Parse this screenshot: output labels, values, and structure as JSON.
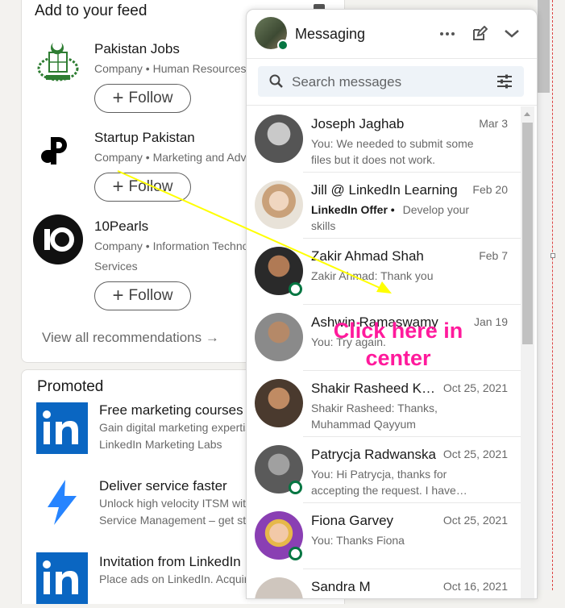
{
  "feed": {
    "title": "Add to your feed",
    "items": [
      {
        "name": "Pakistan Jobs",
        "sub": "Company • Human Resources",
        "sub2": "",
        "follow": "Follow"
      },
      {
        "name": "Startup Pakistan",
        "sub": "Company • Marketing and Advertising",
        "sub2": "",
        "follow": "Follow"
      },
      {
        "name": "10Pearls",
        "sub": "Company • Information Technology",
        "sub2": "Services",
        "follow": "Follow"
      }
    ],
    "view_all": "View all recommendations →"
  },
  "promoted": {
    "title": "Promoted",
    "items": [
      {
        "title": "Free marketing courses",
        "line1": "Gain digital marketing expertise",
        "line2": "LinkedIn Marketing Labs"
      },
      {
        "title": "Deliver service faster",
        "line1": "Unlock high velocity ITSM with",
        "line2": "Service Management – get started"
      },
      {
        "title": "Invitation from LinkedIn",
        "line1": "Place ads on LinkedIn. Acquire",
        "line2": ""
      }
    ]
  },
  "messaging": {
    "title": "Messaging",
    "search_placeholder": "Search messages",
    "conversations": [
      {
        "name": "Joseph Jaghab",
        "date": "Mar 3",
        "bold": "",
        "preview": "You: We needed to submit some files but it does not work.",
        "online": false
      },
      {
        "name": "Jill @ LinkedIn Learning",
        "date": "Feb 20",
        "bold": "LinkedIn Offer •",
        "preview": "Develop your skills",
        "online": false
      },
      {
        "name": "Zakir Ahmad Shah",
        "date": "Feb 7",
        "bold": "",
        "preview": "Zakir Ahmad: Thank you",
        "online": true
      },
      {
        "name": "Ashwin Ramaswamy",
        "date": "Jan 19",
        "bold": "",
        "preview": "You: Try again.",
        "online": false
      },
      {
        "name": "Shakir Rasheed Khan",
        "date": "Oct 25, 2021",
        "bold": "",
        "preview": "Shakir Rasheed: Thanks, Muhammad Qayyum",
        "online": false
      },
      {
        "name": "Patrycja Radwanska",
        "date": "Oct 25, 2021",
        "bold": "",
        "preview": "You: Hi Patrycja, thanks for accepting the request. I have…",
        "online": true
      },
      {
        "name": "Fiona Garvey",
        "date": "Oct 25, 2021",
        "bold": "",
        "preview": "You: Thanks Fiona",
        "online": true
      },
      {
        "name": "Sandra M",
        "date": "Oct 16, 2021",
        "bold": "",
        "preview": "",
        "online": false
      }
    ]
  },
  "annotation": {
    "text": "Click here in center",
    "color": "#ff1a9c",
    "arrow_color": "#ffff00"
  },
  "colors": {
    "online": "#057642",
    "linkedin_blue": "#0a66c2",
    "search_bg": "#eef3f8"
  }
}
